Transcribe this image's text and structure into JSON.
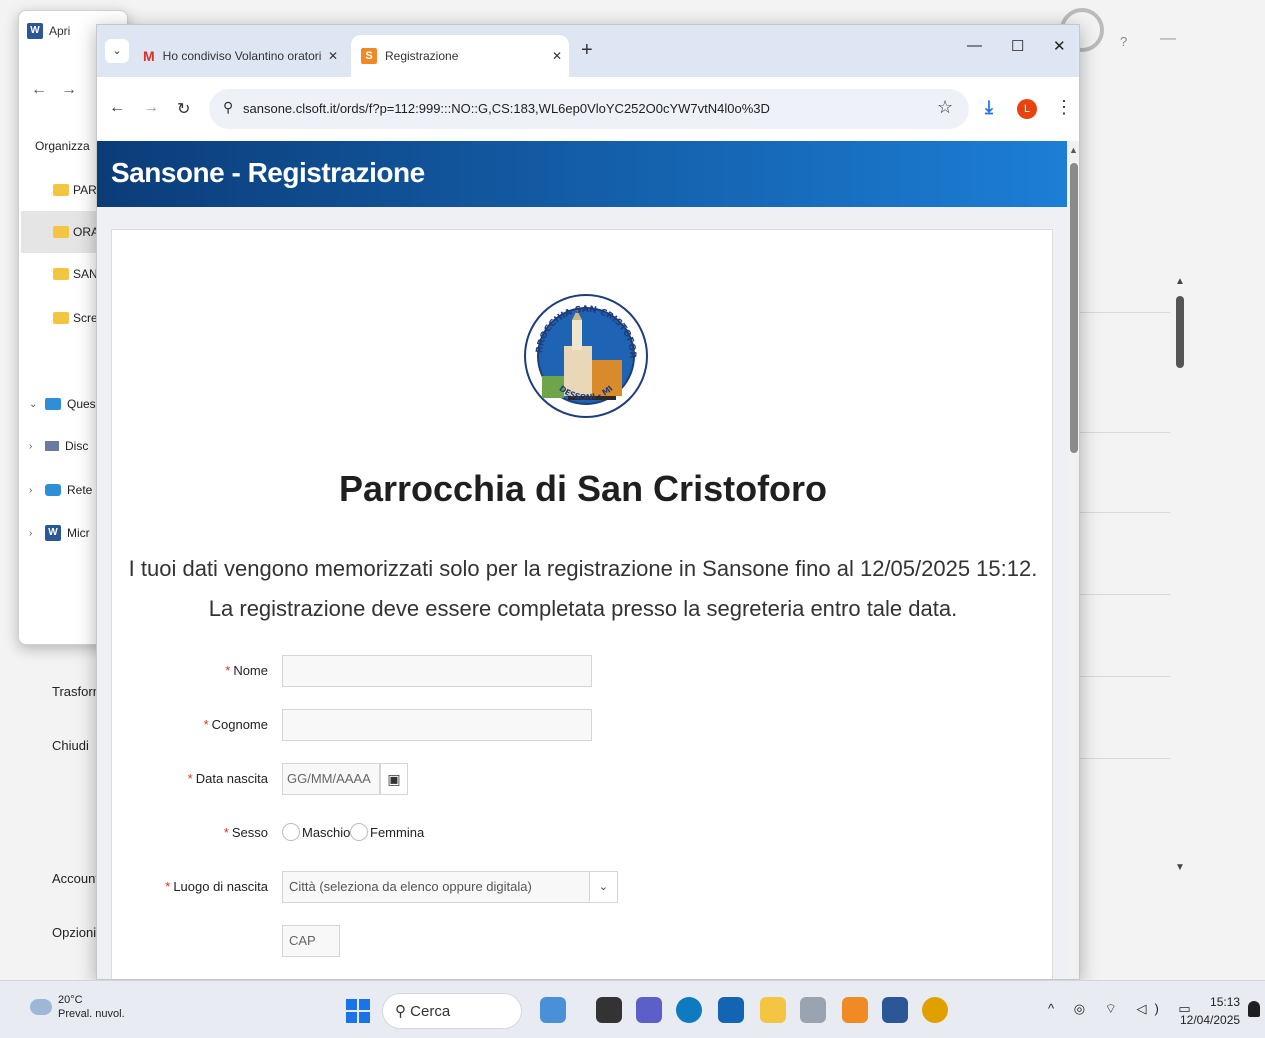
{
  "word": {
    "title": "Apri",
    "organize": "Organizza",
    "folders": [
      "PARR",
      "ORAT",
      "SANS",
      "Scree"
    ],
    "tree": [
      "Ques",
      "Disc",
      "Rete",
      "Micr"
    ],
    "menu": [
      "Trasform",
      "Chiudi",
      "Account",
      "Opzioni"
    ],
    "help": "?"
  },
  "browser": {
    "tabs": [
      {
        "label": "Ho condiviso Volantino oratorio",
        "icon": "gmail-icon"
      },
      {
        "label": "Registrazione",
        "icon": "sansone-icon"
      }
    ],
    "url": "sansone.clsoft.it/ords/f?p=112:999:::NO::G,CS:183,WL6ep0VloYC252O0cYW7vtN4l0o%3D",
    "avatar_letter": "L"
  },
  "page": {
    "header_title": "Sansone - Registrazione",
    "logo_text_top": "PARROCCHIA SAN CRISTOFORO",
    "logo_text_bottom": "DESSONI - MI",
    "org_name": "Parrocchia di San Cristoforo",
    "info_line1": "I tuoi dati vengono memorizzati solo per la registrazione in Sansone fino al 12/05/2025 15:12.",
    "info_line2": "La registrazione deve essere completata presso la segreteria entro tale data.",
    "form": {
      "required_mark": "*",
      "nome_label": "Nome",
      "nome_value": "",
      "cognome_label": "Cognome",
      "cognome_value": "",
      "data_label": "Data nascita",
      "data_placeholder": "GG/MM/AAAA",
      "sesso_label": "Sesso",
      "sesso_options": [
        "Maschio",
        "Femmina"
      ],
      "luogo_label": "Luogo di nascita",
      "luogo_placeholder": "Città (seleziona da elenco oppure digitala)",
      "cap_placeholder": "CAP"
    }
  },
  "taskbar": {
    "weather_temp": "20°C",
    "weather_desc": "Preval. nuvol.",
    "search": "Cerca",
    "time": "15:13",
    "date": "12/04/2025"
  },
  "colors": {
    "header_start": "#0b3c78",
    "header_end": "#1c7ed6",
    "required": "#d93025"
  }
}
